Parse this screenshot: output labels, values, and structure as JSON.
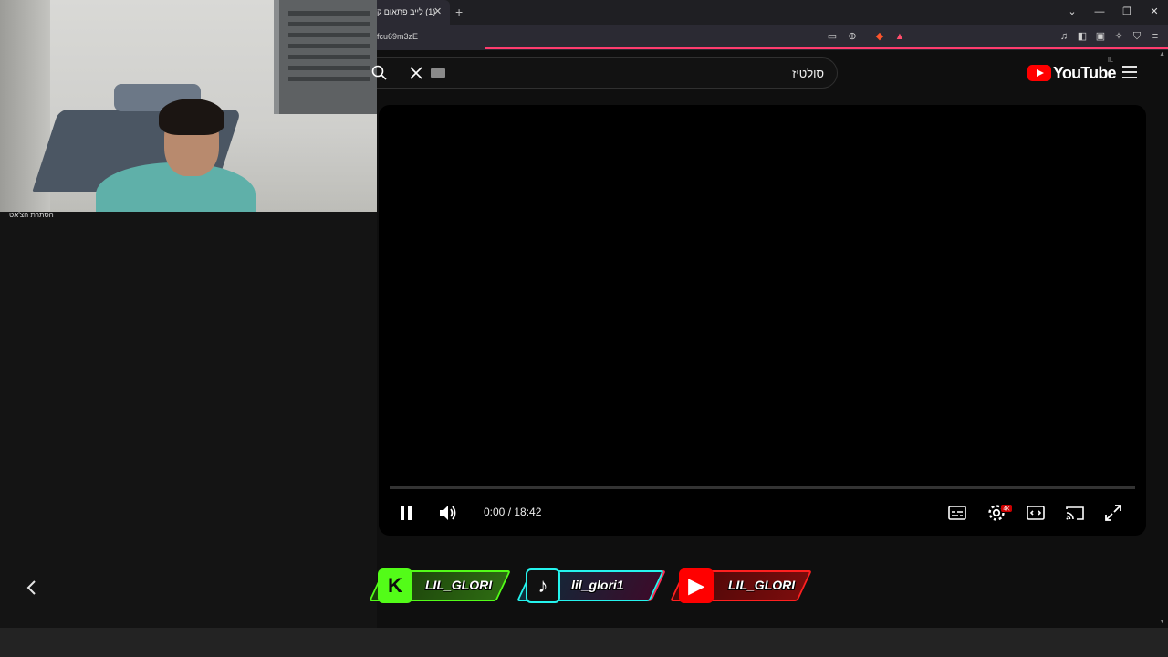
{
  "browser": {
    "tab_title": "(1) לייב פתאום ק",
    "url_fragment": "fcu69m3zE"
  },
  "webcam": {
    "caption": "הסתרת הצ'אט"
  },
  "youtube": {
    "search_query": "סולטיז",
    "logo_text": "YouTube",
    "country_code": "IL"
  },
  "player": {
    "time_display": "0:00 / 18:42",
    "quality_badge": "4K"
  },
  "socials": [
    {
      "platform": "kick",
      "handle": "LIL_GLORI",
      "color": "#53fc18"
    },
    {
      "platform": "tiktok",
      "handle": "lil_glori1",
      "color": "#25f4ee"
    },
    {
      "platform": "youtube",
      "handle": "LIL_GLORI",
      "color": "#ff0000"
    }
  ],
  "colors": {
    "accent": "#ff0000",
    "progress": "#ff3c6e",
    "background": "#0f0f0f"
  }
}
